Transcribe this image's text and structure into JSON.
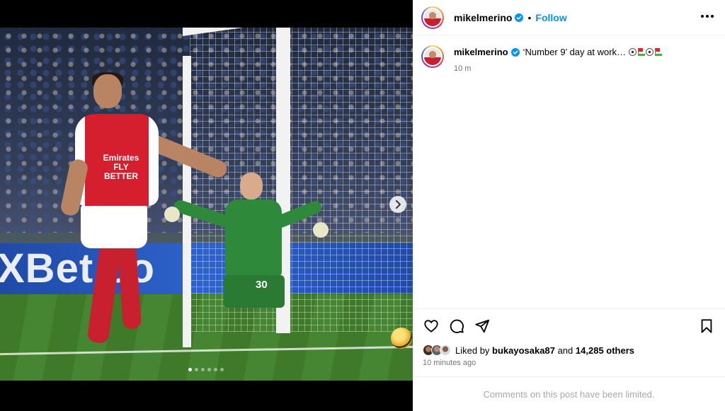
{
  "post": {
    "username": "mikelmerino",
    "verified": true,
    "separator": "•",
    "follow_label": "Follow",
    "caption": "‘Number 9’ day at work…",
    "caption_emoji": [
      "soccer-ball",
      "flag-in-hole",
      "soccer-ball",
      "flag-in-hole"
    ],
    "relative_time": "10 m",
    "liked_by_prefix": "Liked by",
    "liked_by_user": "bukayosaka87",
    "liked_by_and": "and",
    "likes_others": "14,285 others",
    "posted_ago": "10 minutes ago",
    "comments_limited": "Comments on this post have been limited."
  },
  "media": {
    "sponsor_board": "XBet.co",
    "shirt_sponsor": "Emirates FLY BETTER",
    "keeper_number": "30",
    "carousel_total": 6,
    "carousel_active": 1
  },
  "icons": {
    "more": "more-options-icon",
    "like": "heart-icon",
    "comment": "comment-icon",
    "share": "share-icon",
    "save": "bookmark-icon",
    "next": "chevron-right-icon",
    "verified": "verified-badge-icon"
  },
  "colors": {
    "accent": "#0095f6",
    "muted": "#737373",
    "limited": "#a8a8a8",
    "arsenal_red": "#d51f2e"
  }
}
